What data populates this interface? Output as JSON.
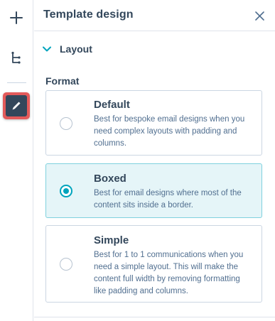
{
  "panel": {
    "title": "Template design",
    "section": {
      "label": "Layout",
      "expanded": true
    },
    "format_label": "Format",
    "options": [
      {
        "title": "Default",
        "description": "Best for bespoke email designs when you need complex layouts with padding and columns.",
        "selected": false
      },
      {
        "title": "Boxed",
        "description": "Best for email designs where most of the content sits inside a border.",
        "selected": true
      },
      {
        "title": "Simple",
        "description": "Best for 1 to 1 communications when you need a simple layout. This will make the content full width by removing formatting like padding and columns.",
        "selected": false
      }
    ]
  },
  "rail": {
    "items": [
      {
        "icon": "plus-icon"
      },
      {
        "icon": "tree-structure-icon"
      },
      {
        "icon": "pencil-icon",
        "active": true
      }
    ]
  },
  "colors": {
    "accent": "#00a4bd",
    "selected_bg": "#e5f5f8",
    "highlight": "#e35a5a",
    "text": "#33475b"
  }
}
